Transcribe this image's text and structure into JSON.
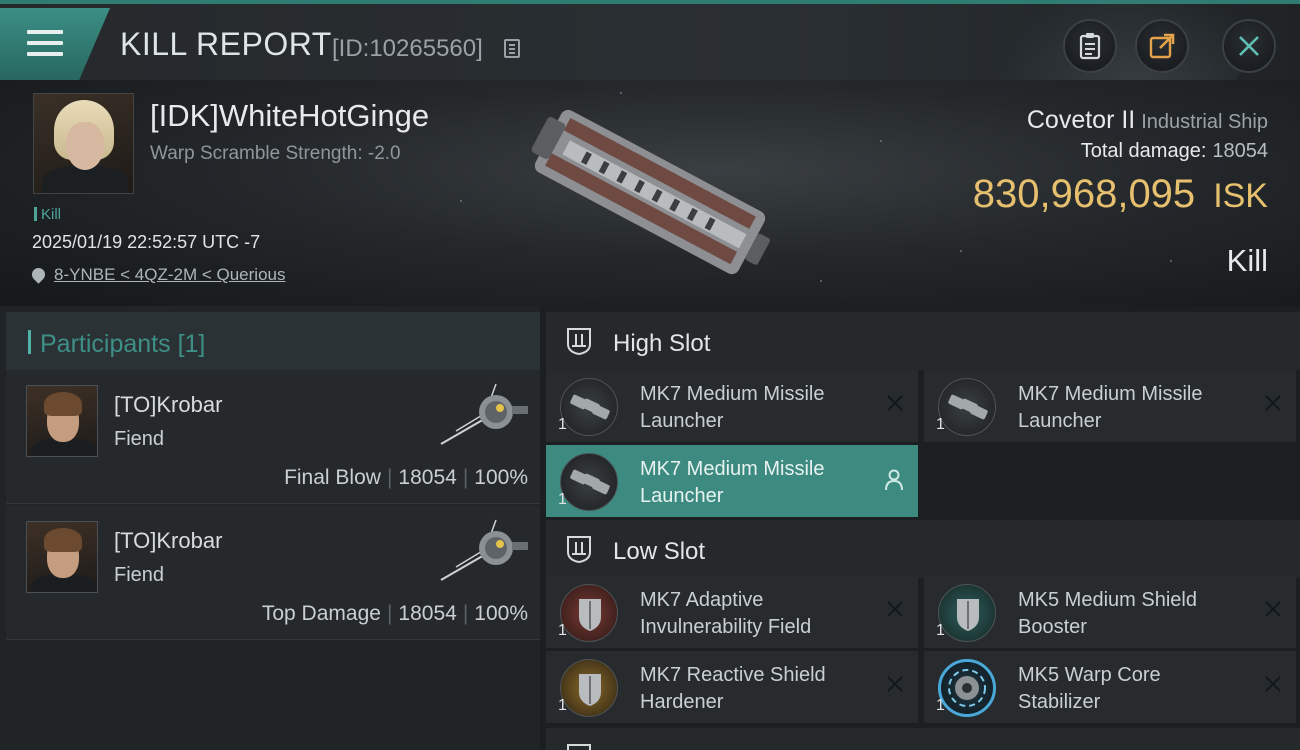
{
  "topbar": {
    "title": "KILL REPORT",
    "report_id": "[ID:10265560]",
    "icons": [
      "menu-icon",
      "copy-icon",
      "clipboard-icon",
      "share-icon",
      "close-icon"
    ]
  },
  "victim": {
    "name": "[IDK]WhiteHotGinge",
    "warp_scramble": "Warp Scramble Strength: -2.0",
    "tag": "Kill",
    "timestamp": "2025/01/19 22:52:57 UTC -7",
    "location": "8-YNBE < 4QZ-2M < Querious"
  },
  "ship": {
    "name": "Covetor II",
    "class": "Industrial Ship",
    "total_damage_label": "Total damage:",
    "total_damage": "18054",
    "isk_value": "830,968,095",
    "isk_unit": "ISK",
    "result": "Kill"
  },
  "participants": {
    "header": "Participants",
    "count": "[1]",
    "items": [
      {
        "name": "[TO]Krobar",
        "ship": "Fiend",
        "role": "Final Blow",
        "damage": "18054",
        "percent": "100%"
      },
      {
        "name": "[TO]Krobar",
        "ship": "Fiend",
        "role": "Top Damage",
        "damage": "18054",
        "percent": "100%"
      }
    ]
  },
  "fitting": {
    "high_slot": {
      "label": "High Slot",
      "modules": [
        {
          "name": "MK7 Medium Missile Launcher",
          "qty": "1"
        },
        {
          "name": "MK7 Medium Missile Launcher",
          "qty": "1"
        },
        {
          "name": "MK7 Medium Missile Launcher",
          "qty": "1"
        }
      ]
    },
    "low_slot": {
      "label": "Low Slot",
      "modules": [
        {
          "name": "MK7 Adaptive Invulnerability Field",
          "qty": "1"
        },
        {
          "name": "MK5 Medium Shield Booster",
          "qty": "1"
        },
        {
          "name": "MK7 Reactive Shield Hardener",
          "qty": "1"
        },
        {
          "name": "MK5 Warp Core Stabilizer",
          "qty": "1"
        }
      ]
    }
  },
  "colors": {
    "accent": "#3c8a80",
    "isk": "#e6c06e",
    "header_teal": "#2f7c73"
  }
}
